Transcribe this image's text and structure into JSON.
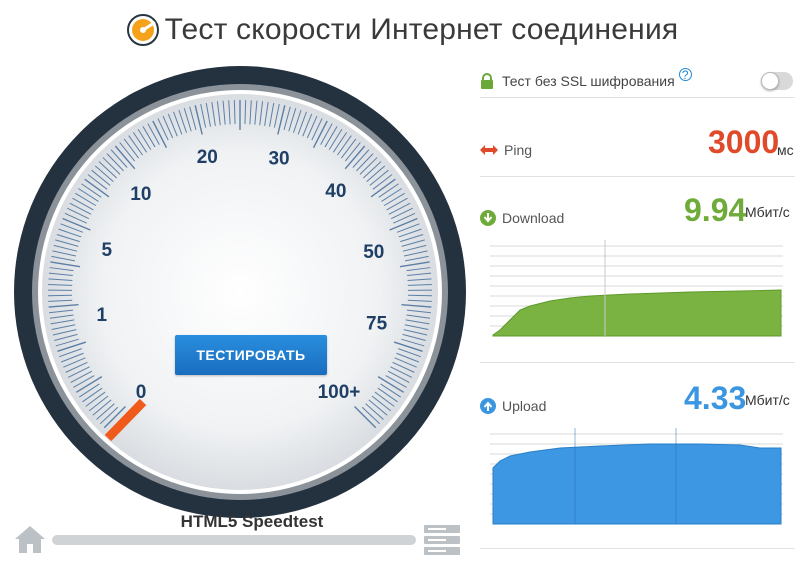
{
  "header": {
    "title": "Тест скорости Интернет соединения"
  },
  "gauge": {
    "scale_labels": [
      "0",
      "1",
      "5",
      "10",
      "20",
      "30",
      "40",
      "50",
      "75",
      "100+"
    ],
    "button_label": "ТЕСТИРОВАТЬ",
    "caption": "HTML5 Speedtest",
    "needle_color": "#f05a1a",
    "progress_percent": 0
  },
  "ssl": {
    "label": "Тест без SSL шифрования",
    "help": "?",
    "enabled": false
  },
  "ping": {
    "label": "Ping",
    "value": "3000",
    "unit": "мс",
    "color": "#e04a2a"
  },
  "download": {
    "label": "Download",
    "value": "9.94",
    "unit": "Мбит/с",
    "color": "#6fab3a"
  },
  "upload": {
    "label": "Upload",
    "value": "4.33",
    "unit": "Мбит/с",
    "color": "#3a96e0"
  },
  "colors": {
    "accent_blue": "#1e8ad6",
    "button_blue": "#1f78c8",
    "dial_dark": "#2a3542",
    "tick_blue": "#5c7fa6"
  }
}
